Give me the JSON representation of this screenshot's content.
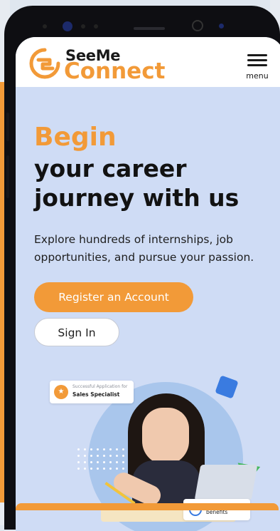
{
  "brand": {
    "top": "SeeMe",
    "bottom": "Connect",
    "orange": "#f29a38"
  },
  "nav": {
    "menu_label": "menu"
  },
  "hero": {
    "highlight": "Begin",
    "title": "your career journey with us",
    "subtitle": "Explore hundreds of internships, job opportunities, and pursue your passion."
  },
  "actions": {
    "register": "Register an Account",
    "sign_in": "Sign In"
  },
  "illustration": {
    "application_card": {
      "caption": "Successful Application for",
      "role": "Sales Specialist"
    },
    "benefit_card": {
      "text": "Full time with benefits"
    }
  }
}
